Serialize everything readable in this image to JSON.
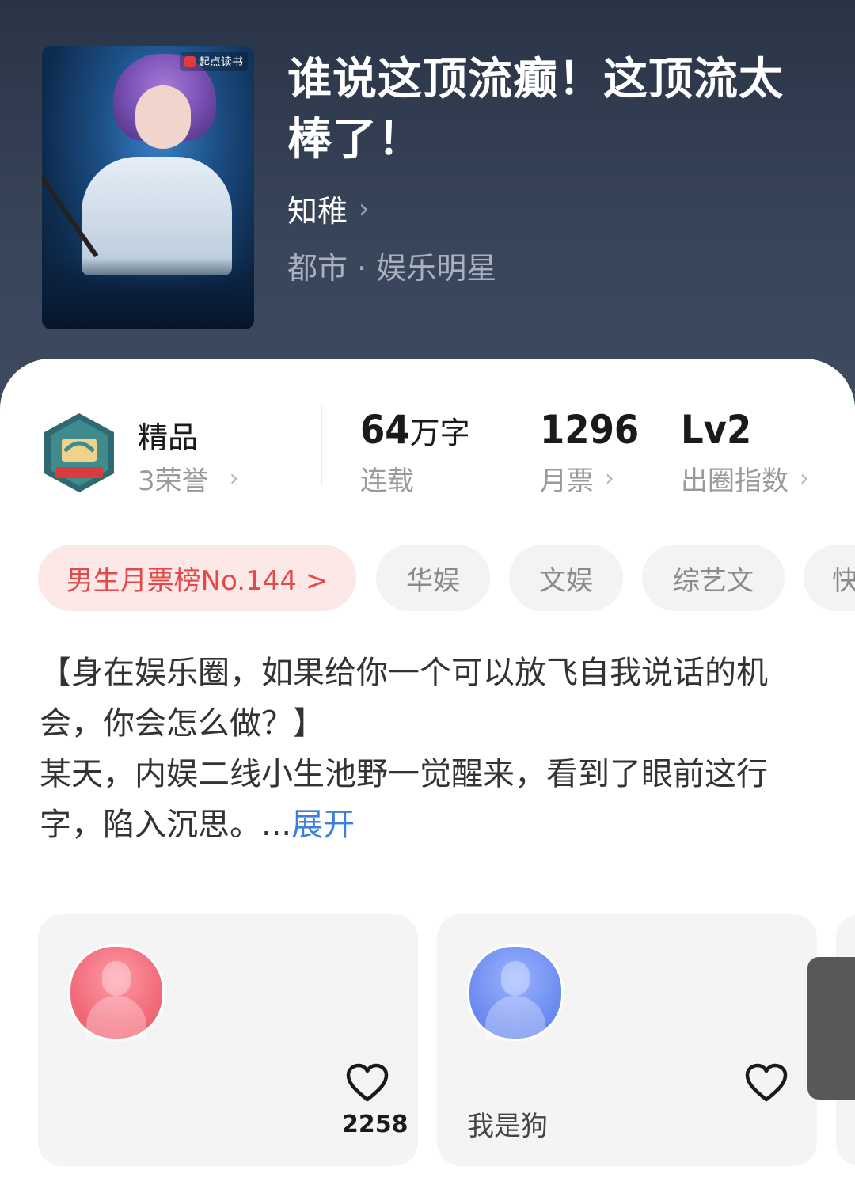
{
  "book": {
    "cover_badge": "起点读书",
    "title": "谁说这顶流癫！这顶流太棒了！",
    "author": "知稚",
    "genre": "都市 · 娱乐明星"
  },
  "stats": {
    "quality_label": "精品",
    "honors_label": "3荣誉",
    "word_count_value": "64",
    "word_count_unit": "万字",
    "word_count_label": "连载",
    "monthly_votes_value": "1296",
    "monthly_votes_label": "月票",
    "popularity_value": "Lv2",
    "popularity_label": "出圈指数"
  },
  "tags": {
    "rank": "男生月票榜No.144 >",
    "items": [
      "华娱",
      "文娱",
      "综艺文",
      "快"
    ]
  },
  "synopsis": {
    "line1": "【身在娱乐圈，如果给你一个可以放飞自我说话的机会，你会怎么做？】",
    "line2": "某天，内娱二线小生池野一觉醒来，看到了眼前这行字，陷入沉思。...",
    "expand": "展开"
  },
  "fans": [
    {
      "likes": "2258",
      "nickname": ""
    },
    {
      "likes": "",
      "nickname": "我是狗"
    }
  ],
  "colors": {
    "rank_bg": "#fde8e8",
    "rank_text": "#e24a4a",
    "expand_link": "#3b7fd8"
  }
}
